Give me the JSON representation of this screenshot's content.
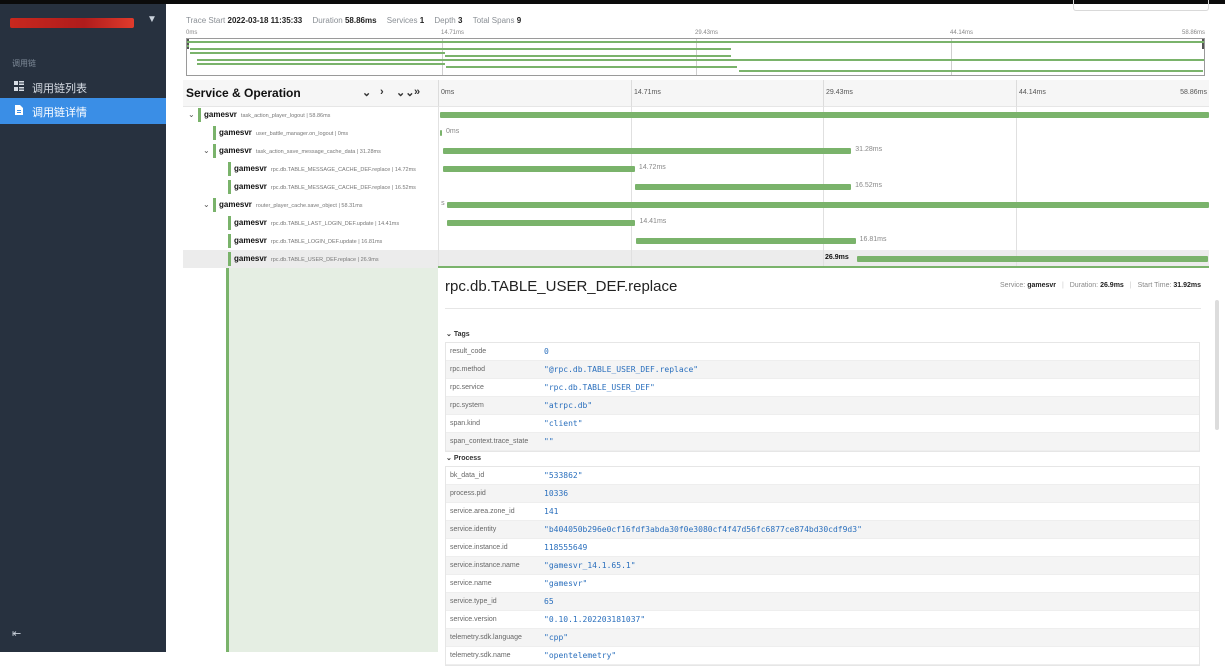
{
  "sidebar": {
    "group_label": "调用链",
    "items": [
      {
        "label": "调用链列表",
        "icon": "list-icon",
        "active": false
      },
      {
        "label": "调用链详情",
        "icon": "document-icon",
        "active": true
      }
    ]
  },
  "trace_meta": {
    "start_label": "Trace Start",
    "start_value": "2022-03-18 11:35:33",
    "duration_label": "Duration",
    "duration_value": "58.86ms",
    "services_label": "Services",
    "services_value": "1",
    "depth_label": "Depth",
    "depth_value": "3",
    "total_spans_label": "Total Spans",
    "total_spans_value": "9"
  },
  "ticks": [
    "0ms",
    "14.71ms",
    "29.43ms",
    "44.14ms",
    "58.86ms"
  ],
  "table_header": {
    "title": "Service & Operation",
    "controls": [
      "⌄",
      "›",
      "⌄⌄",
      "»"
    ]
  },
  "spans": [
    {
      "service": "gamesvr",
      "operation": "task_action_player_logout | 58.86ms",
      "depth": 0,
      "toggle": "⌄",
      "start": 0,
      "dur": 58.86,
      "label": ""
    },
    {
      "service": "gamesvr",
      "operation": "user_battle_manager.on_logout | 0ms",
      "depth": 1,
      "toggle": "",
      "start": 0,
      "dur": 0.1,
      "label": "0ms"
    },
    {
      "service": "gamesvr",
      "operation": "task_action_save_message_cache_data | 31.28ms",
      "depth": 1,
      "toggle": "⌄",
      "start": 0.2,
      "dur": 31.28,
      "label": "31.28ms"
    },
    {
      "service": "gamesvr",
      "operation": "rpc.db.TABLE_MESSAGE_CACHE_DEF.replace | 14.72ms",
      "depth": 2,
      "toggle": "",
      "start": 0.2,
      "dur": 14.72,
      "label": "14.72ms"
    },
    {
      "service": "gamesvr",
      "operation": "rpc.db.TABLE_MESSAGE_CACHE_DEF.replace | 16.52ms",
      "depth": 2,
      "toggle": "",
      "start": 14.95,
      "dur": 16.52,
      "label": "16.52ms"
    },
    {
      "service": "gamesvr",
      "operation": "router_player_cache.save_object | 58.31ms",
      "depth": 1,
      "toggle": "⌄",
      "start": 0.55,
      "dur": 58.31,
      "label": "s"
    },
    {
      "service": "gamesvr",
      "operation": "rpc.db.TABLE_LAST_LOGIN_DEF.update | 14.41ms",
      "depth": 2,
      "toggle": "",
      "start": 0.55,
      "dur": 14.41,
      "label": "14.41ms"
    },
    {
      "service": "gamesvr",
      "operation": "rpc.db.TABLE_LOGIN_DEF.update | 16.81ms",
      "depth": 2,
      "toggle": "",
      "start": 15.0,
      "dur": 16.81,
      "label": "16.81ms"
    },
    {
      "service": "gamesvr",
      "operation": "rpc.db.TABLE_USER_DEF.replace | 26.9ms",
      "depth": 2,
      "toggle": "",
      "start": 31.92,
      "dur": 26.9,
      "label": "26.9ms",
      "selected": true
    }
  ],
  "detail": {
    "title": "rpc.db.TABLE_USER_DEF.replace",
    "service_label": "Service:",
    "service_value": "gamesvr",
    "duration_label": "Duration:",
    "duration_value": "26.9ms",
    "start_label": "Start Time:",
    "start_value": "31.92ms",
    "tags_title": "Tags",
    "tags": [
      {
        "k": "result_code",
        "v": "0"
      },
      {
        "k": "rpc.method",
        "v": "\"@rpc.db.TABLE_USER_DEF.replace\""
      },
      {
        "k": "rpc.service",
        "v": "\"rpc.db.TABLE_USER_DEF\""
      },
      {
        "k": "rpc.system",
        "v": "\"atrpc.db\""
      },
      {
        "k": "span.kind",
        "v": "\"client\""
      },
      {
        "k": "span_context.trace_state",
        "v": "\"\""
      }
    ],
    "process_title": "Process",
    "process": [
      {
        "k": "bk_data_id",
        "v": "\"533862\""
      },
      {
        "k": "process.pid",
        "v": "10336"
      },
      {
        "k": "service.area.zone_id",
        "v": "141"
      },
      {
        "k": "service.identity",
        "v": "\"b404050b296e0cf16fdf3abda30f0e3080cf4f47d56fc6877ce874bd30cdf9d3\""
      },
      {
        "k": "service.instance.id",
        "v": "118555649"
      },
      {
        "k": "service.instance.name",
        "v": "\"gamesvr_14.1.65.1\""
      },
      {
        "k": "service.name",
        "v": "\"gamesvr\""
      },
      {
        "k": "service.type_id",
        "v": "65"
      },
      {
        "k": "service.version",
        "v": "\"0.10.1.202203181037\""
      },
      {
        "k": "telemetry.sdk.language",
        "v": "\"cpp\""
      },
      {
        "k": "telemetry.sdk.name",
        "v": "\"opentelemetry\""
      }
    ]
  },
  "colors": {
    "accent": "#3a8ee6",
    "span": "#7ab36b",
    "sidebar": "#27313f"
  }
}
